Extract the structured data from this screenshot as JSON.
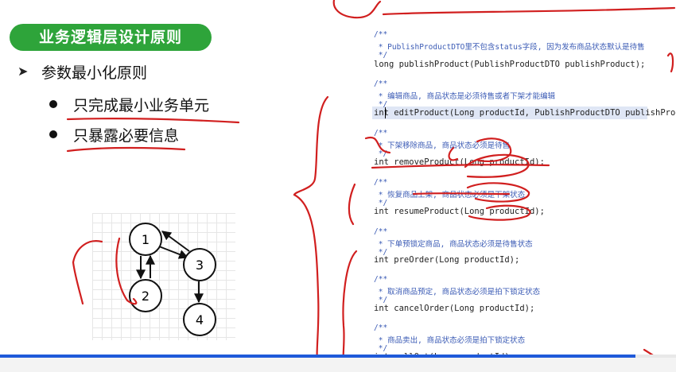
{
  "slide": {
    "title": "业务逻辑层设计原则",
    "principle": "参数最小化原则",
    "points": [
      "只完成最小业务单元",
      "只暴露必要信息"
    ]
  },
  "code": [
    {
      "kind": "cm",
      "text": "/**"
    },
    {
      "kind": "cm",
      "text": " * PublishProductDTO里不包含status字段, 因为发布商品状态默认是待售"
    },
    {
      "kind": "cm",
      "text": " */"
    },
    {
      "kind": "sig",
      "text": "long publishProduct(PublishProductDTO publishProduct);"
    },
    {
      "kind": "cm",
      "text": "/**"
    },
    {
      "kind": "cm",
      "text": " * 编辑商品, 商品状态是必须待售或者下架才能编辑"
    },
    {
      "kind": "cm",
      "text": " */"
    },
    {
      "kind": "sig",
      "text": "int editProduct(Long productId, PublishProductDTO publishProduct);"
    },
    {
      "kind": "cm",
      "text": "/**"
    },
    {
      "kind": "cm",
      "text": " * 下架移除商品, 商品状态必须是待售"
    },
    {
      "kind": "cm",
      "text": " */"
    },
    {
      "kind": "sig",
      "text": "int removeProduct(Long productId);"
    },
    {
      "kind": "cm",
      "text": "/**"
    },
    {
      "kind": "cm",
      "text": " * 恢复商品上架, 商品状态必须是下架状态"
    },
    {
      "kind": "cm",
      "text": " */"
    },
    {
      "kind": "sig",
      "text": "int resumeProduct(Long productId);"
    },
    {
      "kind": "cm",
      "text": "/**"
    },
    {
      "kind": "cm",
      "text": " * 下单预锁定商品, 商品状态必须是待售状态"
    },
    {
      "kind": "cm",
      "text": " */"
    },
    {
      "kind": "sig",
      "text": "int preOrder(Long productId);"
    },
    {
      "kind": "cm",
      "text": "/**"
    },
    {
      "kind": "cm",
      "text": " * 取消商品预定, 商品状态必须是拍下锁定状态"
    },
    {
      "kind": "cm",
      "text": " */"
    },
    {
      "kind": "sig",
      "text": "int cancelOrder(Long productId);"
    },
    {
      "kind": "cm",
      "text": "/**"
    },
    {
      "kind": "cm",
      "text": " * 商品卖出, 商品状态必须是拍下锁定状态"
    },
    {
      "kind": "cm",
      "text": " */"
    },
    {
      "kind": "sig",
      "text": "int sellOut(Long productId);"
    }
  ],
  "graph": {
    "nodes": [
      "1",
      "2",
      "3",
      "4"
    ]
  },
  "player": {
    "progress": 0.94,
    "colors": {
      "accent": "#1f5ad9",
      "title_bg": "#2ea43a",
      "ink": "#d11f1f"
    }
  }
}
